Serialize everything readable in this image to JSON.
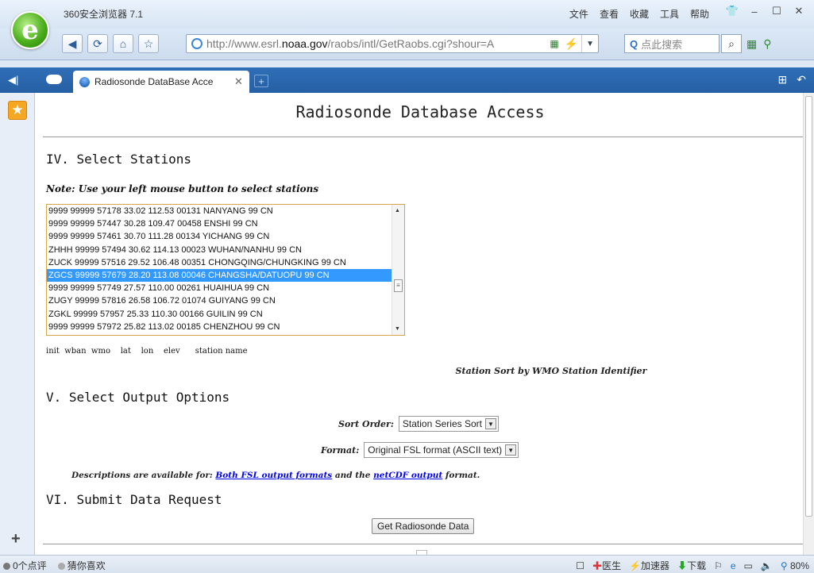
{
  "browser": {
    "app_title": "360安全浏览器 7.1",
    "menu": [
      "文件",
      "查看",
      "收藏",
      "工具",
      "帮助"
    ],
    "window_buttons": [
      "minimize-icon",
      "maximize-icon",
      "close-icon"
    ],
    "url_prefix": "http://www.esrl.",
    "url_domain": "noaa.gov",
    "url_rest": "/raobs/intl/GetRaobs.cgi?shour=A",
    "search_placeholder": "点此搜索",
    "tab_label": "Radiosonde DataBase Acce",
    "status_left": [
      "0个点评",
      "猜你喜欢"
    ],
    "status_right": [
      "医生",
      "加速器",
      "下载"
    ],
    "zoom": "80%"
  },
  "page": {
    "title": "Radiosonde Database Access",
    "section4_heading": "IV.  Select Stations",
    "note": "Note: Use your left mouse button to select stations",
    "stations": [
      "9999 99999 57178 33.02 112.53 00131 NANYANG 99 CN",
      "9999 99999 57447 30.28 109.47 00458 ENSHI 99 CN",
      "9999 99999 57461 30.70 111.28 00134 YICHANG 99 CN",
      "ZHHH 99999 57494 30.62 114.13 00023 WUHAN/NANHU 99 CN",
      "ZUCK 99999 57516 29.52 106.48 00351 CHONGQING/CHUNGKING 99 CN",
      "ZGCS 99999 57679 28.20 113.08 00046 CHANGSHA/DATUOPU 99 CN",
      "9999 99999 57749 27.57 110.00 00261 HUAIHUA 99 CN",
      "ZUGY 99999 57816 26.58 106.72 01074 GUIYANG 99 CN",
      "ZGKL 99999 57957 25.33 110.30 00166 GUILIN 99 CN",
      "9999 99999 57972 25.82 113.02 00185 CHENZHOU 99 CN"
    ],
    "selected_station_index": 5,
    "column_headers": "init  wban  wmo    lat    lon    elev      station name",
    "station_sort": "Station Sort by WMO Station Identifier",
    "section5_heading": "V.  Select Output Options",
    "sort_order_label": "Sort Order:",
    "sort_order_value": "Station Series Sort",
    "format_label": "Format:",
    "format_value": "Original FSL format (ASCII text)",
    "desc_prefix": "Descriptions are available for: ",
    "desc_link1": "Both FSL output formats",
    "desc_mid": " and the ",
    "desc_link2": "netCDF output",
    "desc_suffix": " format.",
    "section6_heading": "VI.  Submit Data Request",
    "submit_label": "Get Radiosonde Data"
  }
}
